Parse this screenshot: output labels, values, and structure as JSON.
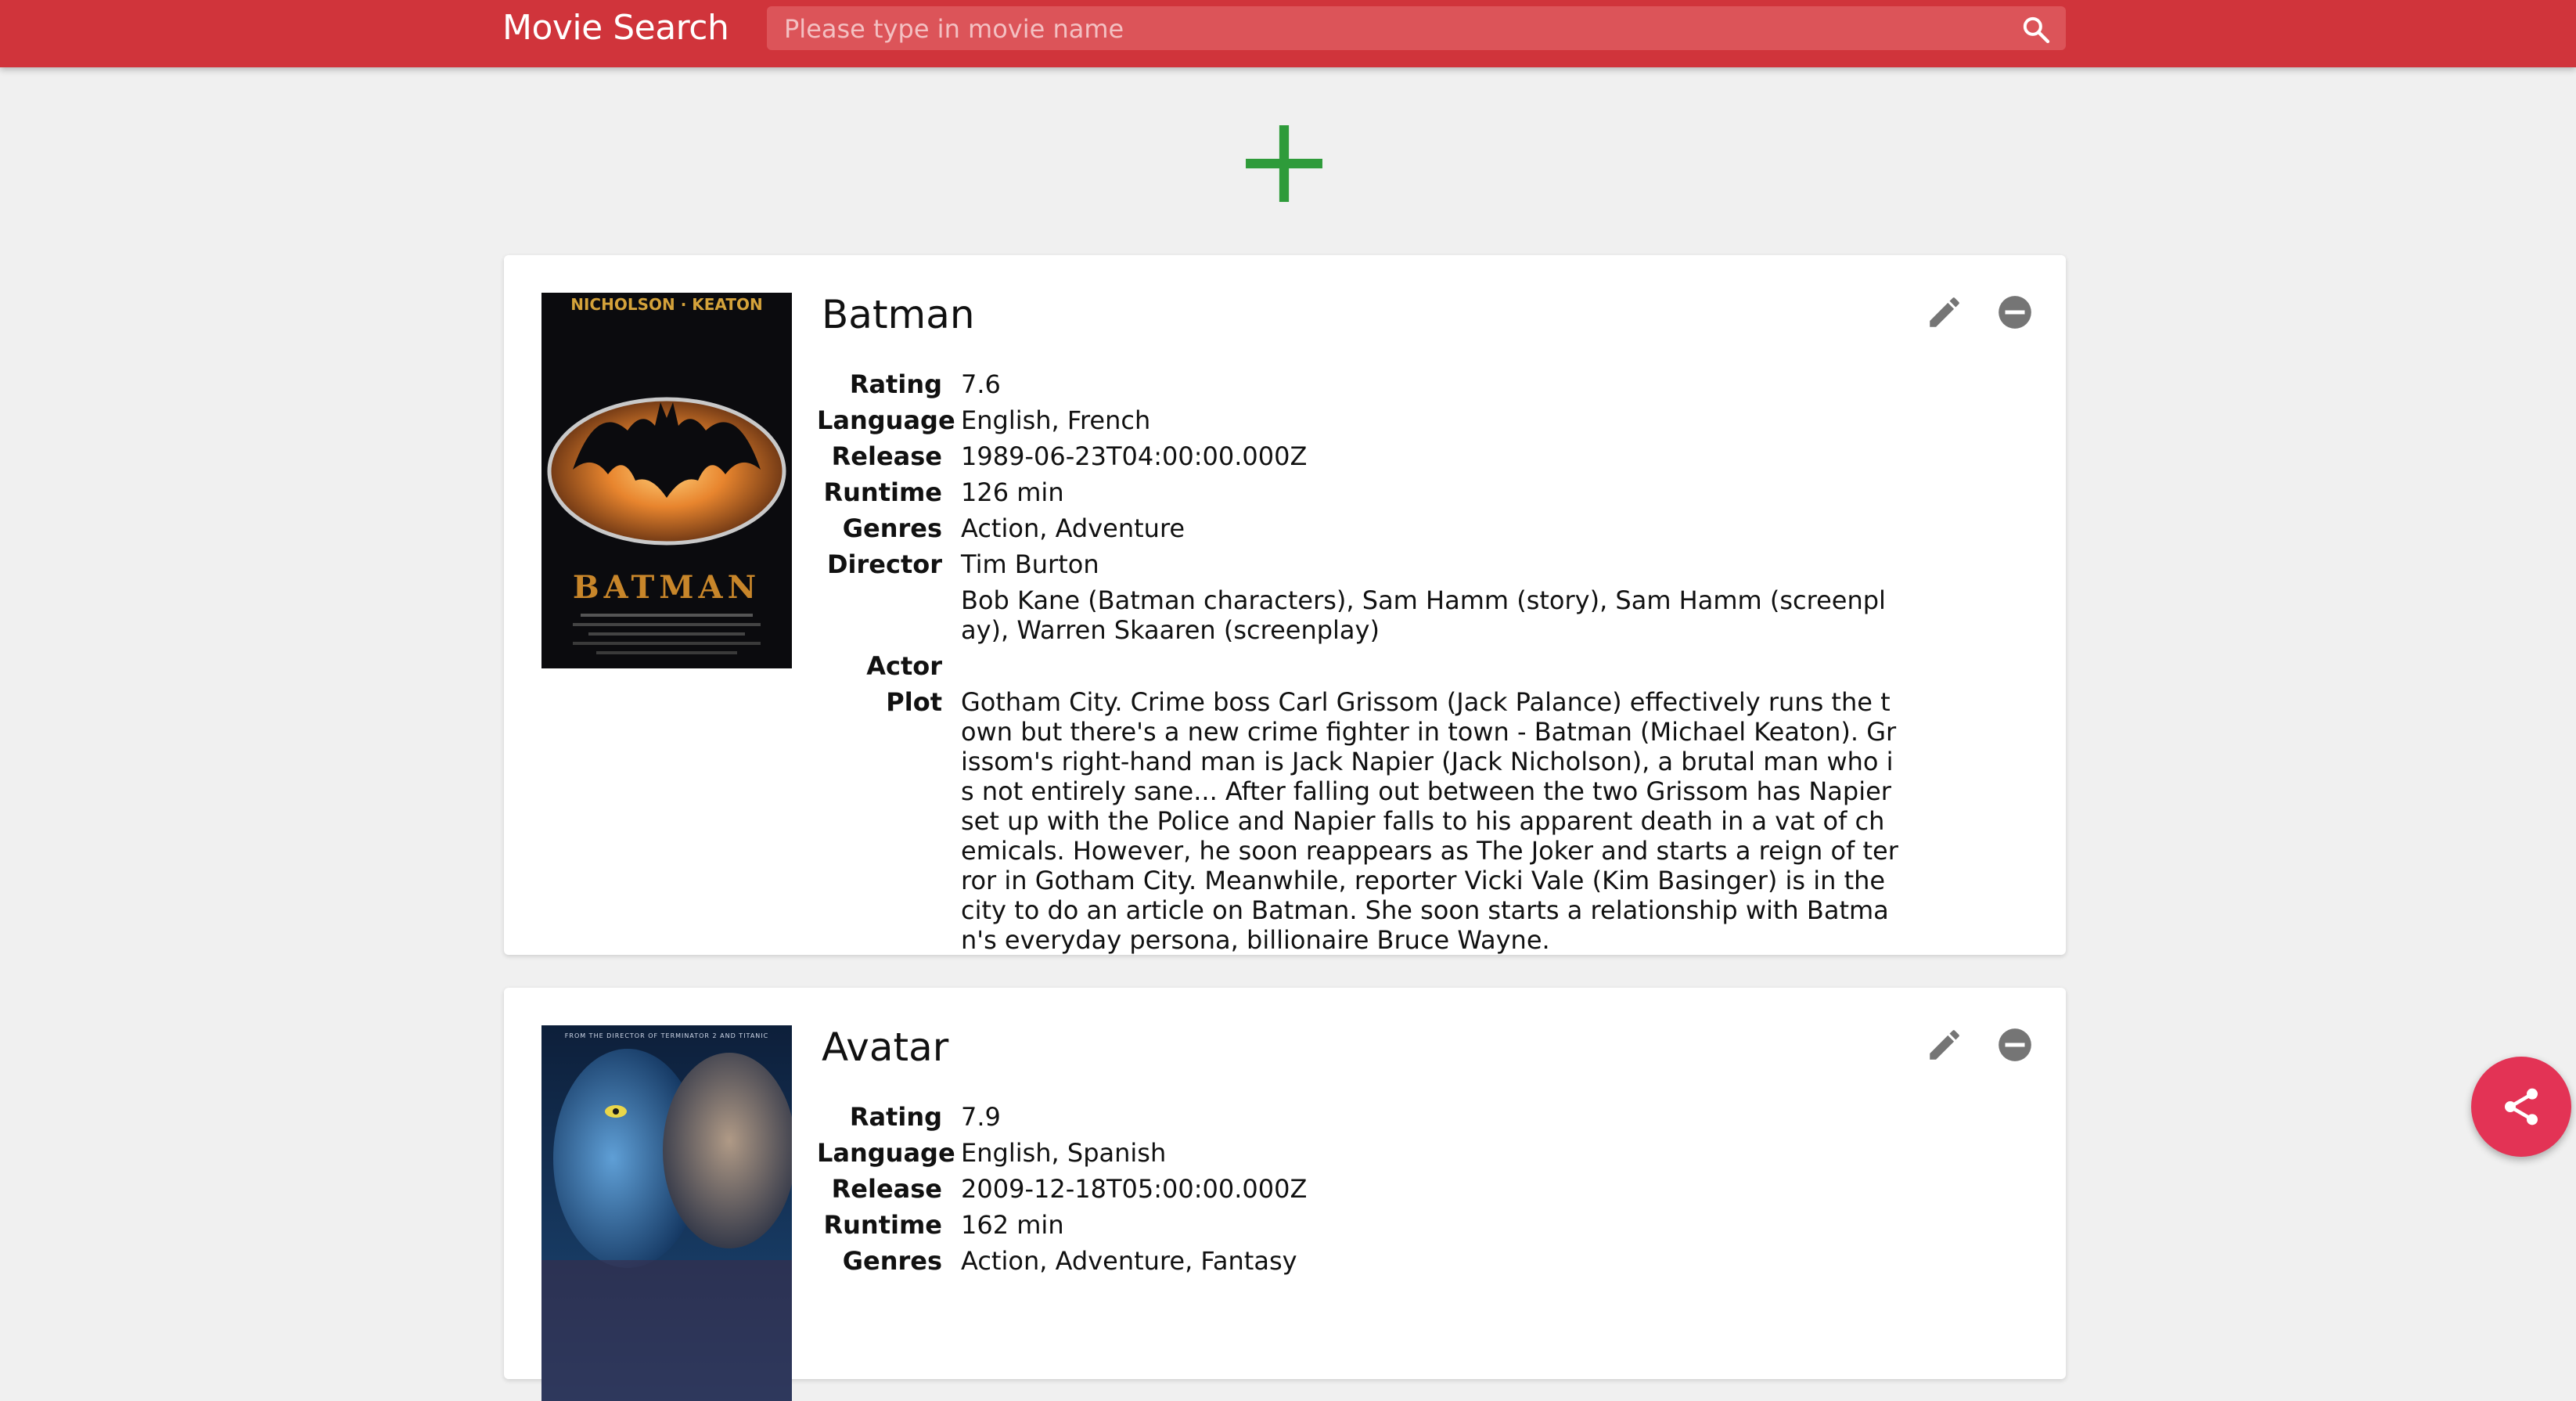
{
  "app": {
    "title": "Movie Search",
    "accent_color": "#d0343b",
    "add_color": "#2e9b3a",
    "fab_color": "#e33355"
  },
  "search": {
    "placeholder": "Please type in movie name",
    "value": "",
    "icon": "search-icon"
  },
  "labels": {
    "rating": "Rating",
    "language": "Language",
    "release": "Release",
    "runtime": "Runtime",
    "genres": "Genres",
    "director": "Director",
    "writer": "",
    "actor": "Actor",
    "plot": "Plot"
  },
  "movies": [
    {
      "title": "Batman",
      "poster": {
        "top_text": "NICHOLSON · KEATON",
        "title_text": "BATMAN"
      },
      "rating": "7.6",
      "language": "English, French",
      "release": "1989-06-23T04:00:00.000Z",
      "runtime": "126 min",
      "genres": "Action, Adventure",
      "director": "Tim Burton",
      "writer": "Bob Kane (Batman characters), Sam Hamm (story), Sam Hamm (screenplay), Warren Skaaren (screenplay)",
      "actor": "",
      "plot": "Gotham City. Crime boss Carl Grissom (Jack Palance) effectively runs the town but there's a new crime fighter in town - Batman (Michael Keaton). Grissom's right-hand man is Jack Napier (Jack Nicholson), a brutal man who is not entirely sane... After falling out between the two Grissom has Napier set up with the Police and Napier falls to his apparent death in a vat of chemicals. However, he soon reappears as The Joker and starts a reign of terror in Gotham City. Meanwhile, reporter Vicki Vale (Kim Basinger) is in the city to do an article on Batman. She soon starts a relationship with Batman's everyday persona, billionaire Bruce Wayne."
    },
    {
      "title": "Avatar",
      "poster": {
        "top_text": "FROM THE DIRECTOR OF TERMINATOR 2 AND TITANIC"
      },
      "rating": "7.9",
      "language": "English, Spanish",
      "release": "2009-12-18T05:00:00.000Z",
      "runtime": "162 min",
      "genres": "Action, Adventure, Fantasy"
    }
  ]
}
